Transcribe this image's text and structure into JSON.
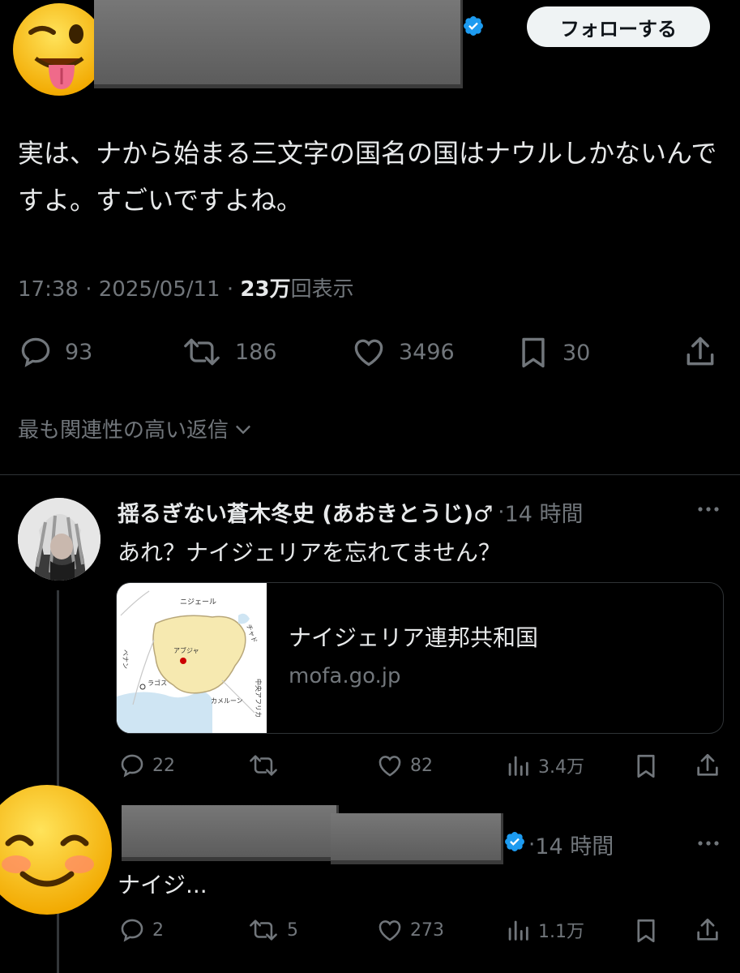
{
  "header": {
    "follow_label": "フォローする"
  },
  "tweet": {
    "text": "実は、ナから始まる三文字の国名の国はナウルしかないんですよ。すごいですよね。",
    "time": "17:38",
    "date": "2025/05/11",
    "views_count": "23万",
    "views_label": "回表示",
    "stats": {
      "replies": "93",
      "retweets": "186",
      "likes": "3496",
      "bookmarks": "30"
    }
  },
  "sort_label": "最も関連性の高い返信",
  "reply1": {
    "name": "揺るぎない蒼木冬史 (あおきとうじ)♂",
    "time": "14 時間",
    "text": "あれ？ナイジェリアを忘れてません？",
    "card": {
      "title": "ナイジェリア連邦共和国",
      "domain": "mofa.go.jp",
      "map_labels": {
        "niger": "ニジェール",
        "chad": "チャド",
        "benin": "ベナン",
        "abuja": "アブジャ",
        "lagos": "ラゴス",
        "cameroon": "カメルーン",
        "car": "中央アフリカ"
      }
    },
    "stats": {
      "replies": "22",
      "retweets": "",
      "likes": "82",
      "views": "3.4万"
    }
  },
  "reply2": {
    "time": "14 時間",
    "text": "ナイジ...",
    "stats": {
      "replies": "2",
      "retweets": "5",
      "likes": "273",
      "views": "1.1万"
    }
  },
  "colors": {
    "background": "#000000",
    "text": "#e7e9ea",
    "muted": "#71767b",
    "verified": "#1d9bf0",
    "divider": "#2f3336"
  }
}
